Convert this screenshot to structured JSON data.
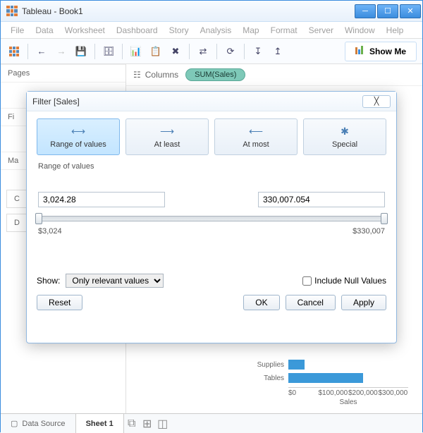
{
  "window": {
    "title": "Tableau - Book1"
  },
  "menu": [
    "File",
    "Data",
    "Worksheet",
    "Dashboard",
    "Story",
    "Analysis",
    "Map",
    "Format",
    "Server",
    "Window",
    "Help"
  ],
  "toolbar": {
    "showme_label": "Show Me"
  },
  "shelves": {
    "pages_label": "Pages",
    "filters_label": "Fi",
    "marks_label": "Ma",
    "c_label": "C",
    "d_label": "D",
    "columns_label": "Columns",
    "pill": "SUM(Sales)"
  },
  "dialog": {
    "title": "Filter [Sales]",
    "tabs": {
      "range": "Range of values",
      "atleast": "At least",
      "atmost": "At most",
      "special": "Special"
    },
    "subhead": "Range of values",
    "input_low": "3,024.28",
    "input_high": "330,007.054",
    "display_low": "$3,024",
    "display_high": "$330,007",
    "show_label": "Show:",
    "show_value": "Only relevant values",
    "null_label": "Include Null Values",
    "reset": "Reset",
    "ok": "OK",
    "cancel": "Cancel",
    "apply": "Apply"
  },
  "status": {
    "datasource": "Data Source",
    "sheet": "Sheet 1"
  },
  "chart_data": {
    "type": "bar",
    "categories": [
      "Supplies",
      "Tables"
    ],
    "values": [
      45000,
      205000
    ],
    "xlabel": "Sales",
    "ticks": [
      "$0",
      "$100,000",
      "$200,000",
      "$300,000"
    ],
    "xlim": [
      0,
      330000
    ]
  }
}
